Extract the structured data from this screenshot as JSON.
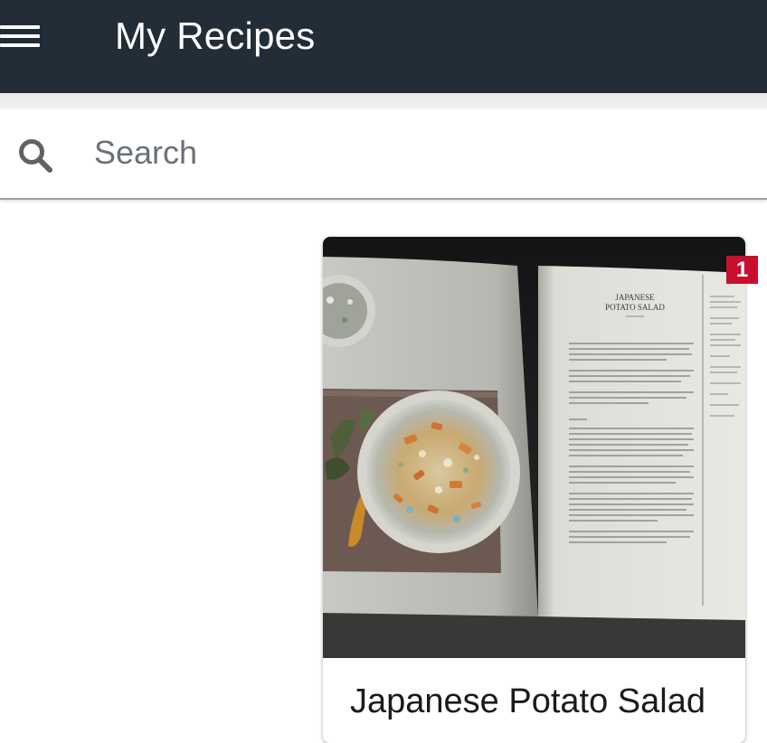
{
  "header": {
    "menu_icon": "hamburger-menu-icon",
    "title": "My Recipes"
  },
  "search": {
    "icon": "search-icon",
    "placeholder": "Search",
    "value": ""
  },
  "recipes": [
    {
      "title": "Japanese Potato Salad",
      "image": "open-cookbook-photo",
      "page_heading": "JAPANESE POTATO SALAD",
      "badge": "1"
    }
  ],
  "colors": {
    "appbar": "#222d38",
    "badge": "#c8102e",
    "search_icon": "#5f6368"
  }
}
